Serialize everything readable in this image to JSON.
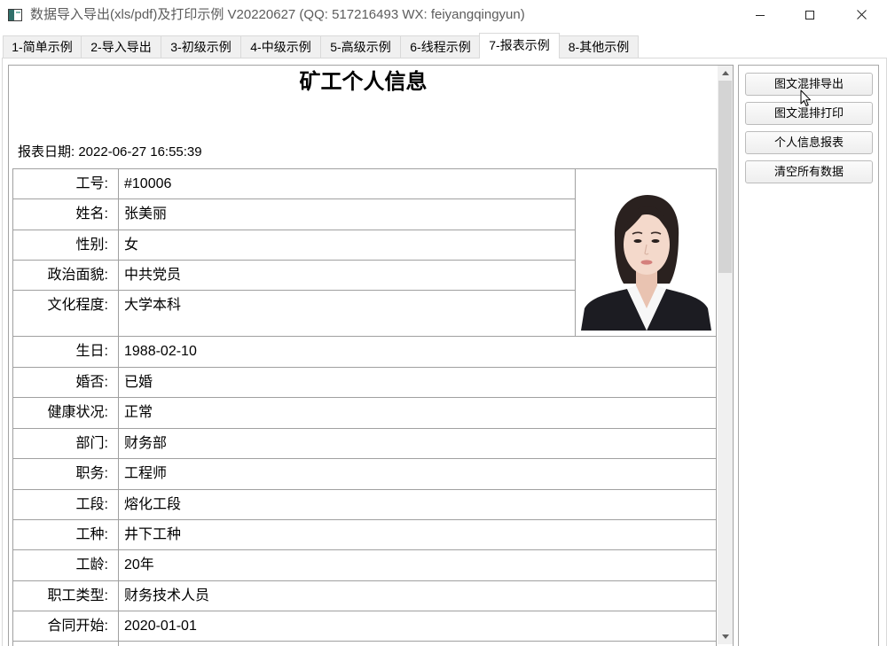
{
  "window": {
    "title": "数据导入导出(xls/pdf)及打印示例 V20220627 (QQ: 517216493 WX: feiyangqingyun)"
  },
  "icons": {
    "app": "app-window-icon",
    "minimize": "minimize-icon",
    "maximize": "maximize-icon",
    "close": "close-icon",
    "scroll_up": "scroll-up-arrow-icon",
    "scroll_down": "scroll-down-arrow-icon",
    "photo": "employee-portrait-photo",
    "cursor": "mouse-cursor-icon"
  },
  "tabs": {
    "items": [
      {
        "label": "1-简单示例",
        "selected": false
      },
      {
        "label": "2-导入导出",
        "selected": false
      },
      {
        "label": "3-初级示例",
        "selected": false
      },
      {
        "label": "4-中级示例",
        "selected": false
      },
      {
        "label": "5-高级示例",
        "selected": false
      },
      {
        "label": "6-线程示例",
        "selected": false
      },
      {
        "label": "7-报表示例",
        "selected": true
      },
      {
        "label": "8-其他示例",
        "selected": false
      }
    ]
  },
  "report": {
    "title": "矿工个人信息",
    "date_line": "报表日期: 2022-06-27 16:55:39",
    "rows": [
      {
        "label": "工号:",
        "value": "#10006"
      },
      {
        "label": "姓名:",
        "value": "张美丽"
      },
      {
        "label": "性别:",
        "value": "女"
      },
      {
        "label": "政治面貌:",
        "value": "中共党员"
      },
      {
        "label": "文化程度:",
        "value": "大学本科"
      },
      {
        "label": "生日:",
        "value": "1988-02-10"
      },
      {
        "label": "婚否:",
        "value": "已婚"
      },
      {
        "label": "健康状况:",
        "value": "正常"
      },
      {
        "label": "部门:",
        "value": "财务部"
      },
      {
        "label": "职务:",
        "value": "工程师"
      },
      {
        "label": "工段:",
        "value": "熔化工段"
      },
      {
        "label": "工种:",
        "value": "井下工种"
      },
      {
        "label": "工龄:",
        "value": "20年"
      },
      {
        "label": "职工类型:",
        "value": "财务技术人员"
      },
      {
        "label": "合同开始:",
        "value": "2020-01-01"
      }
    ]
  },
  "report_view": {
    "scrollbar": {
      "scroll_position_percent": 0,
      "visible_percent": 35
    }
  },
  "actions": {
    "buttons": [
      {
        "label": "图文混排导出"
      },
      {
        "label": "图文混排打印"
      },
      {
        "label": "个人信息报表"
      },
      {
        "label": "清空所有数据"
      }
    ]
  },
  "colors": {
    "window_bg": "#ffffff",
    "tab_inactive_bg": "#f0f0f0",
    "tab_border": "#d9d9d9",
    "table_border": "#a0a0a0",
    "scrollbar_track": "#f0f0f0",
    "scrollbar_thumb": "#d4d4d4",
    "text": "#000000"
  }
}
